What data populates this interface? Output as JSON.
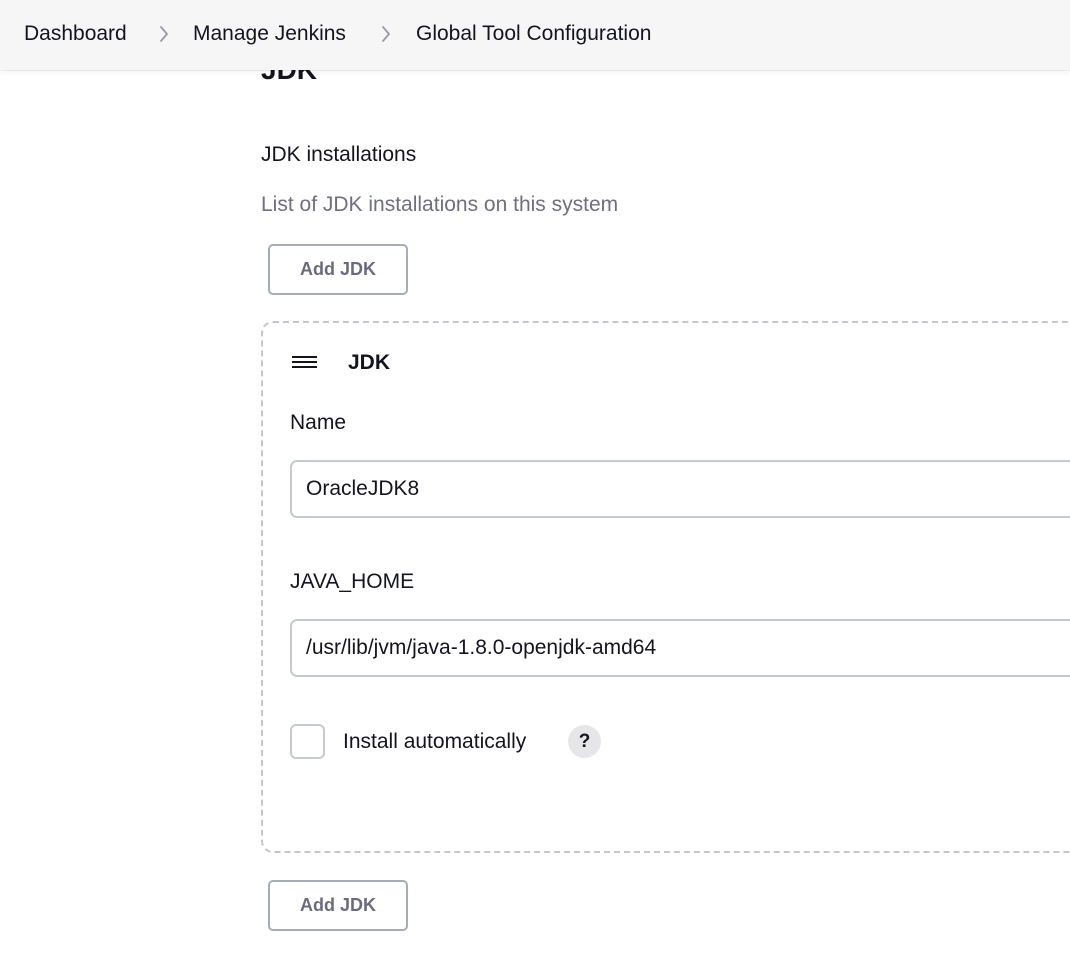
{
  "breadcrumb": {
    "items": [
      {
        "label": "Dashboard"
      },
      {
        "label": "Manage Jenkins"
      },
      {
        "label": "Global Tool Configuration"
      }
    ],
    "separator_icon": "chevron-right-icon"
  },
  "section": {
    "title": "JDK"
  },
  "jdk_installations": {
    "label": "JDK installations",
    "description": "List of JDK installations on this system",
    "add_button_top": "Add JDK",
    "add_button_bottom": "Add JDK",
    "entry": {
      "handle_icon": "drag-handle-icon",
      "title": "JDK",
      "name_label": "Name",
      "name_value": "OracleJDK8",
      "java_home_label": "JAVA_HOME",
      "java_home_value": "/usr/lib/jvm/java-1.8.0-openjdk-amd64",
      "install_automatically_label": "Install automatically",
      "install_automatically_checked": false,
      "help_glyph": "?"
    }
  },
  "colors": {
    "breadcrumb_bg": "#f6f6f7",
    "text": "#14141f",
    "muted_text": "#6f6f80",
    "border": "#c4cacd",
    "button_text": "#6b6b7d"
  }
}
